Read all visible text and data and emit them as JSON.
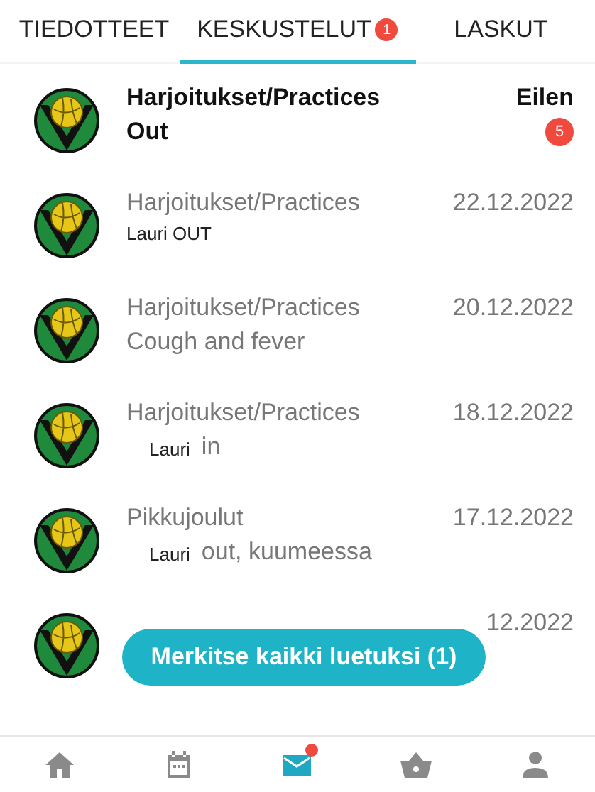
{
  "tabs": [
    {
      "label": "TIEDOTTEET",
      "selected": false
    },
    {
      "label": "KESKUSTELUT",
      "selected": true,
      "badge": "1"
    },
    {
      "label": "LASKUT",
      "selected": false
    }
  ],
  "conversations": [
    {
      "title": "Harjoitukset/Practices",
      "text": "Out",
      "date": "Eilen",
      "unread": true,
      "badge": "5"
    },
    {
      "title": "Harjoitukset/Practices",
      "sender": "Lauri OUT",
      "date": "22.12.2022",
      "unread": false
    },
    {
      "title": "Harjoitukset/Practices",
      "text": "Cough and fever",
      "date": "20.12.2022",
      "unread": false
    },
    {
      "title": "Harjoitukset/Practices",
      "sender": "Lauri",
      "text": "in",
      "date": "18.12.2022",
      "unread": false
    },
    {
      "title": "Pikkujoulut",
      "sender": "Lauri",
      "text": "out, kuumeessa",
      "date": "17.12.2022",
      "unread": false
    },
    {
      "date": "12.2022",
      "unread": false
    }
  ],
  "mark_all_button": "Merkitse kaikki luetuksi (1)",
  "bottom_nav": [
    {
      "kind": "home",
      "selected": false
    },
    {
      "kind": "calendar",
      "selected": false
    },
    {
      "kind": "messages",
      "selected": true,
      "dot": true
    },
    {
      "kind": "shop",
      "selected": false
    },
    {
      "kind": "profile",
      "selected": false
    }
  ]
}
